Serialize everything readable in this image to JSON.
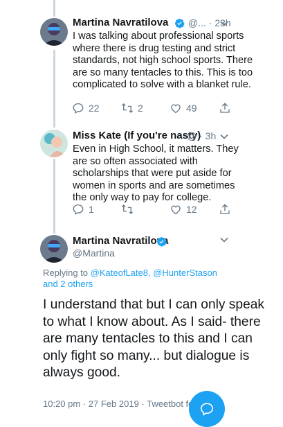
{
  "tweets": [
    {
      "name": "Martina Navratilova",
      "handle": "@...",
      "sep": "·",
      "time": "23h",
      "text": "I was talking about professional sports where there is drug testing and strict standards, not high school sports. There are so many tentacles to this. This is too complicated to solve with a blanket rule.",
      "replies": "22",
      "retweets": "2",
      "likes": "49"
    },
    {
      "name": "Miss Kate (If you're nasty)",
      "handle": "@",
      "sep": "·",
      "time": "3h",
      "text": "Even in High School, it matters. They are so often associated with scholarships that were put aside for women in sports and are sometimes the only way to pay for college.",
      "replies": "1",
      "retweets": "",
      "likes": "12"
    }
  ],
  "main_tweet": {
    "name": "Martina Navratilova",
    "handle": "@Martina",
    "replying_prefix": "Replying to ",
    "replying_user1": "@KateofLate8",
    "replying_comma": ", ",
    "replying_user2": "@HunterStason",
    "replying_others": "and 2 others",
    "text": "I understand that but I can only speak to what I know about. As I said- there are many tentacles to this and I can only fight so many... but dialogue is always good.",
    "timestamp": "10:20 pm",
    "date": "27 Feb 2019",
    "client": "Tweetbot fo"
  },
  "colors": {
    "accent": "#1da1f2",
    "muted": "#657786",
    "line": "#ccd6dd"
  },
  "icons": [
    "reply-icon",
    "retweet-icon",
    "like-icon",
    "share-icon",
    "verified-icon",
    "chevron-down-icon",
    "compose-icon"
  ]
}
